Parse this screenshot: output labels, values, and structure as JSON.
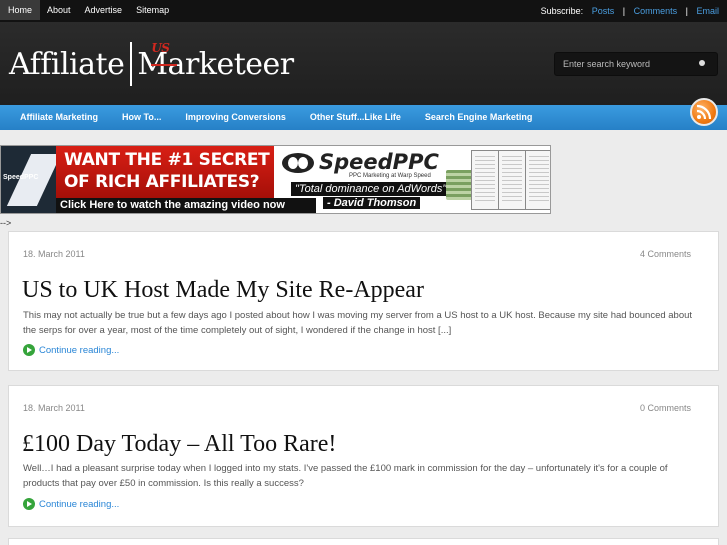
{
  "topnav": {
    "items": [
      "Home",
      "About",
      "Advertise",
      "Sitemap"
    ],
    "subscribe_label": "Subscribe:",
    "subscribe_links": [
      "Posts",
      "Comments",
      "Email"
    ],
    "separator": "|"
  },
  "header": {
    "logo_left": "Affiliate",
    "logo_accent": "M",
    "logo_accent_overlay": "US",
    "logo_right_pre": "a",
    "logo_right": "rketeer",
    "search_placeholder": "Enter search keyword"
  },
  "mainnav": {
    "items": [
      "Affiliate Marketing",
      "How To...",
      "Improving Conversions",
      "Other Stuff...Like Life",
      "Search Engine Marketing"
    ],
    "rss_icon": "rss-icon",
    "rss_color": "#f07a12",
    "bar_color": "#2d8ad2"
  },
  "banner": {
    "left_brand": "SpeedPPC",
    "headline_1": "WANT THE #1 SECRET",
    "headline_2": "OF RICH AFFILIATES?",
    "cta_click": "Click Here",
    "cta_rest": "to watch the amazing video now",
    "brand": "SpeedPPC",
    "tagline": "PPC Marketing at Warp Speed",
    "quote": "\"Total dominance on AdWords\"",
    "author": "- David Thomson"
  },
  "stray_text": "-->",
  "posts": [
    {
      "date": "18. March 2011",
      "comments": "4 Comments",
      "title": "US to UK Host Made My Site Re-Appear",
      "excerpt": "This may not actually be true but a few days ago I posted about how I was moving my server from a US host to a UK host. Because my site had bounced about the serps for over a year, most of the time completely out of sight, I wondered if the change in host [...]",
      "more": "Continue reading..."
    },
    {
      "date": "18. March 2011",
      "comments": "0 Comments",
      "title": "£100 Day Today – All Too Rare!",
      "excerpt": "Well…I had a pleasant surprise today when I logged into my stats. I've passed the £100 mark in commission for the day – unfortunately it's for a couple of products that pay over £50 in commission. Is this really a success?",
      "more": "Continue reading..."
    }
  ],
  "colors": {
    "link_blue": "#2a86d6",
    "accent_red": "#d0281f",
    "arrow_green": "#35a43b"
  }
}
